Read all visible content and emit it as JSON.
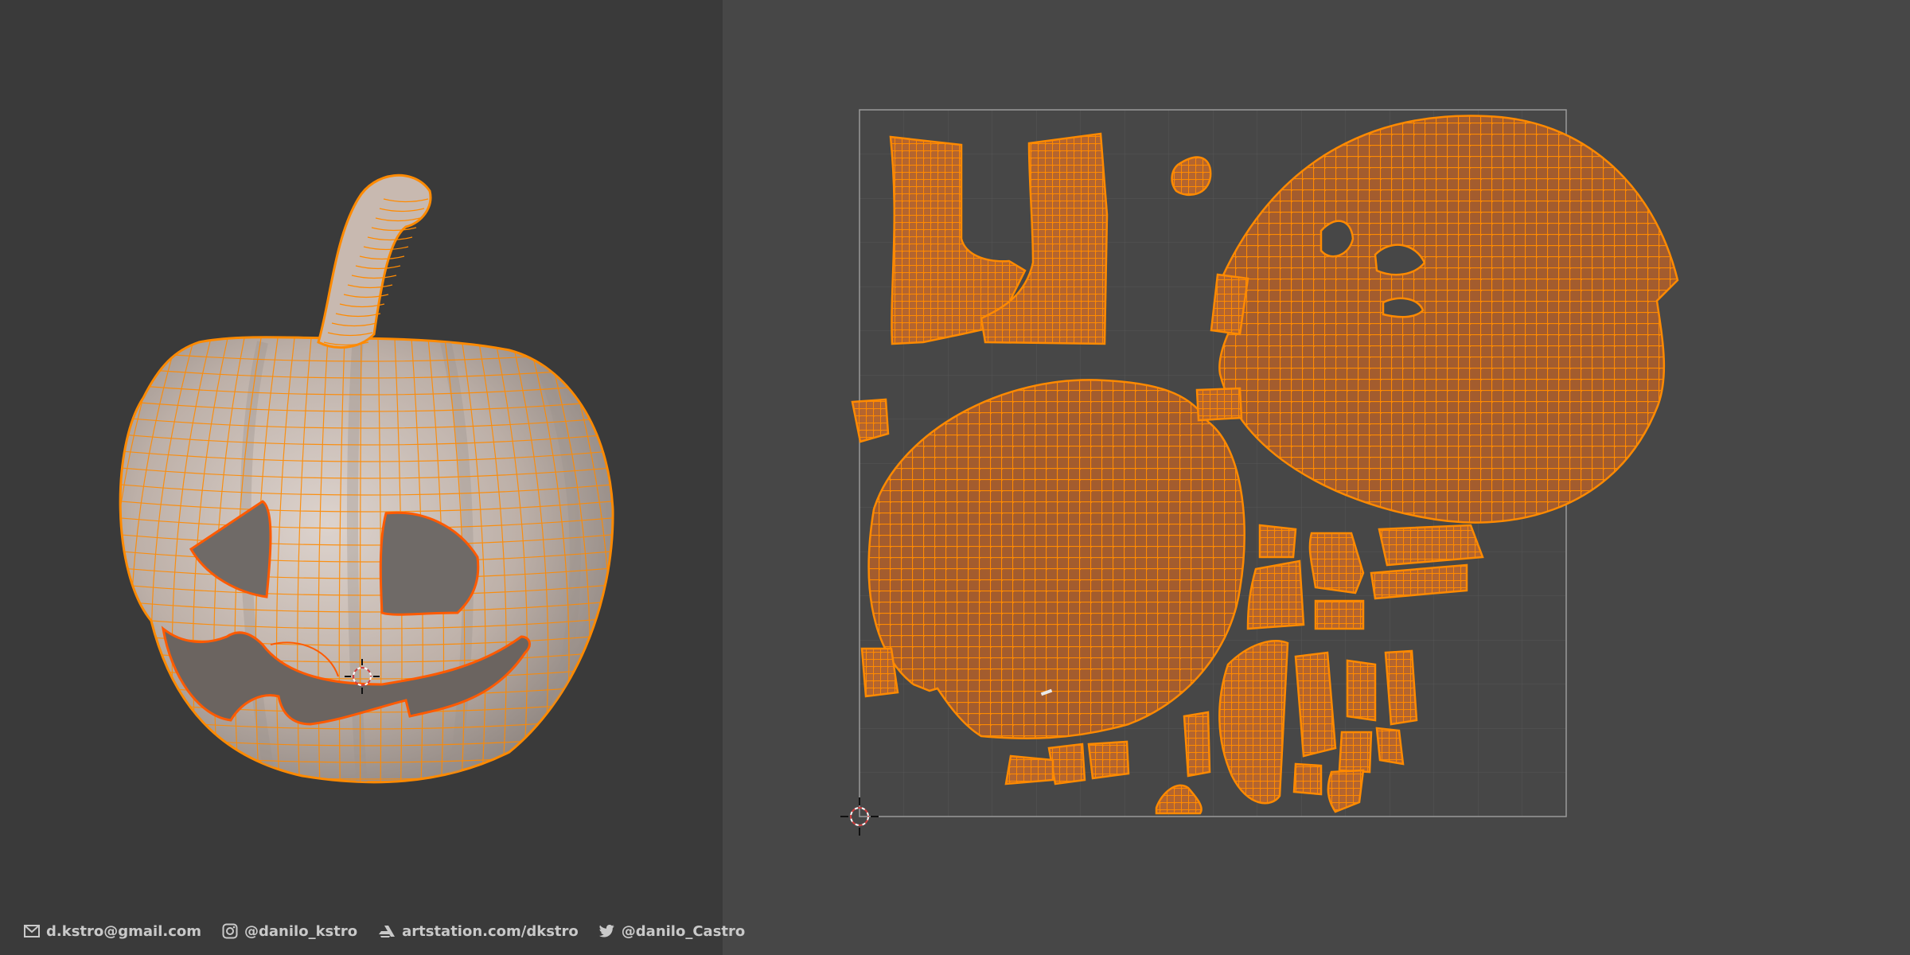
{
  "viewport": {
    "name": "3D Viewport",
    "object": "pumpkin",
    "mode": "edit-mode-wireframe-overlay"
  },
  "uv_editor": {
    "name": "UV Editor",
    "content": "uv-islands-selected"
  },
  "colors": {
    "viewport_bg": "#3a3a3a",
    "uv_bg": "#474747",
    "selection": "#ff8a00",
    "uv_island_fill": "#a35c2e",
    "mesh_surface": "#b8aaa2"
  },
  "footer": {
    "email_icon": "envelope-icon",
    "email": "d.kstro@gmail.com",
    "instagram_icon": "instagram-icon",
    "instagram": "@danilo_kstro",
    "artstation_icon": "artstation-icon",
    "artstation": "artstation.com/dkstro",
    "twitter_icon": "twitter-icon",
    "twitter": "@danilo_Castro"
  }
}
